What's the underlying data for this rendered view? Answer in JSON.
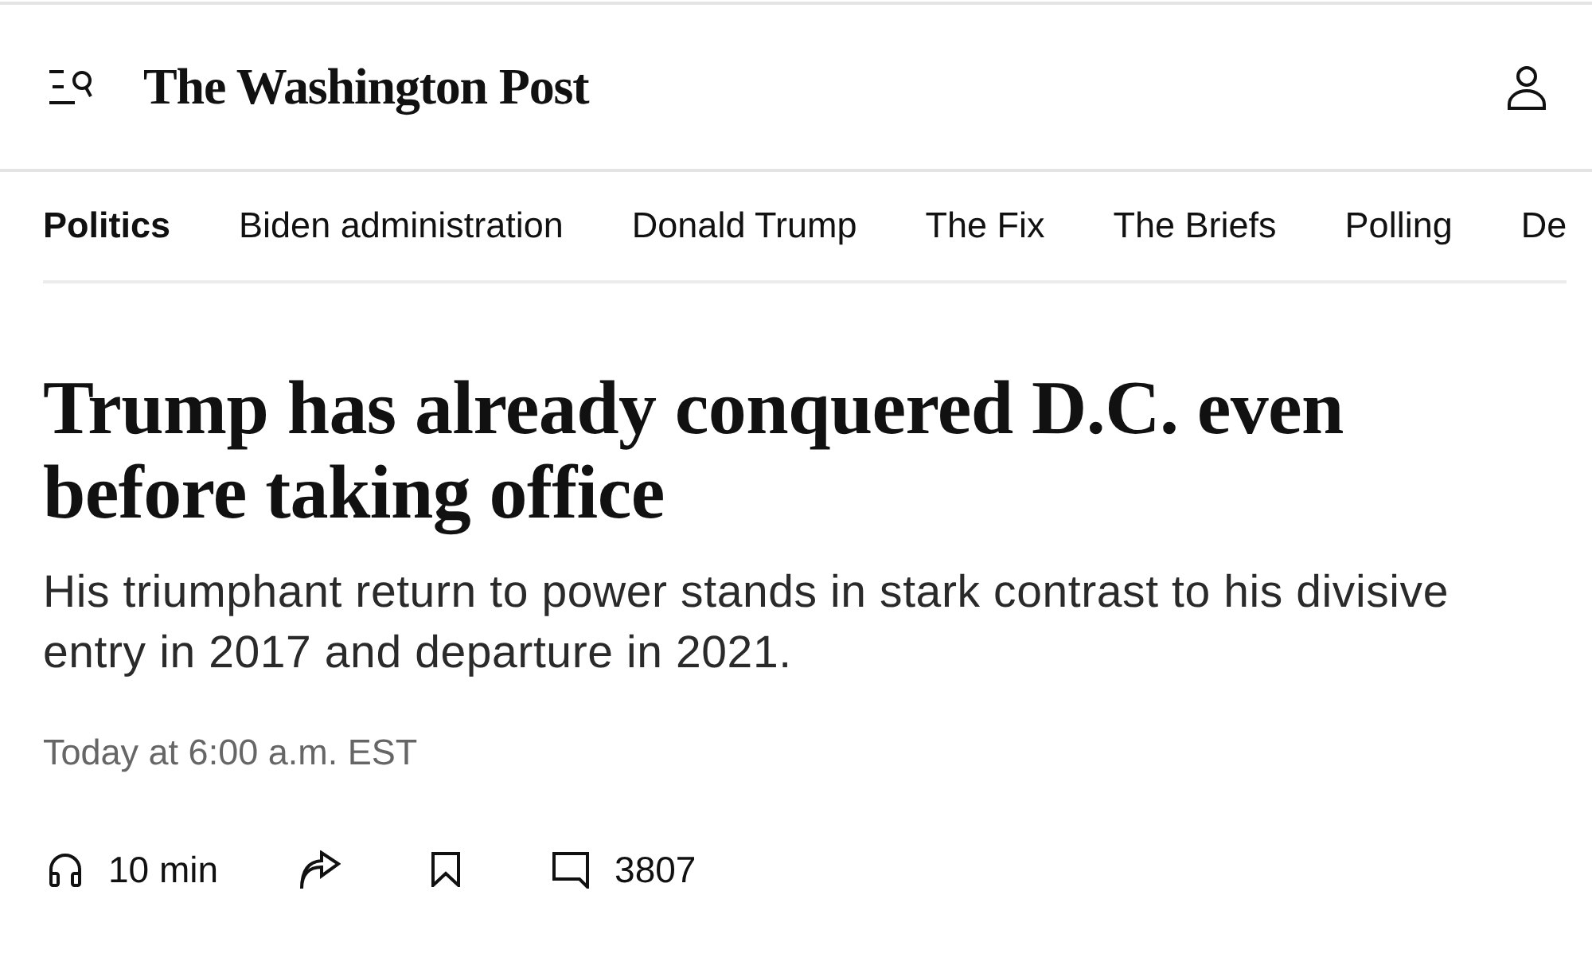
{
  "header": {
    "logo": "The Washington Post"
  },
  "nav": {
    "items": [
      {
        "label": "Politics",
        "selected": true
      },
      {
        "label": "Biden administration",
        "selected": false
      },
      {
        "label": "Donald Trump",
        "selected": false
      },
      {
        "label": "The Fix",
        "selected": false
      },
      {
        "label": "The Briefs",
        "selected": false
      },
      {
        "label": "Polling",
        "selected": false
      },
      {
        "label": "De",
        "selected": false
      }
    ]
  },
  "article": {
    "headline": "Trump has already conquered D.C. even before taking office",
    "subheadline": "His triumphant return to power stands in stark contrast to his divisive entry in 2017 and departure in 2021.",
    "timestamp": "Today at 6:00 a.m. EST"
  },
  "actions": [
    {
      "kind": "listen",
      "label": "10 min"
    },
    {
      "kind": "share"
    },
    {
      "kind": "bookmark"
    },
    {
      "kind": "comments",
      "label": "3807"
    }
  ]
}
